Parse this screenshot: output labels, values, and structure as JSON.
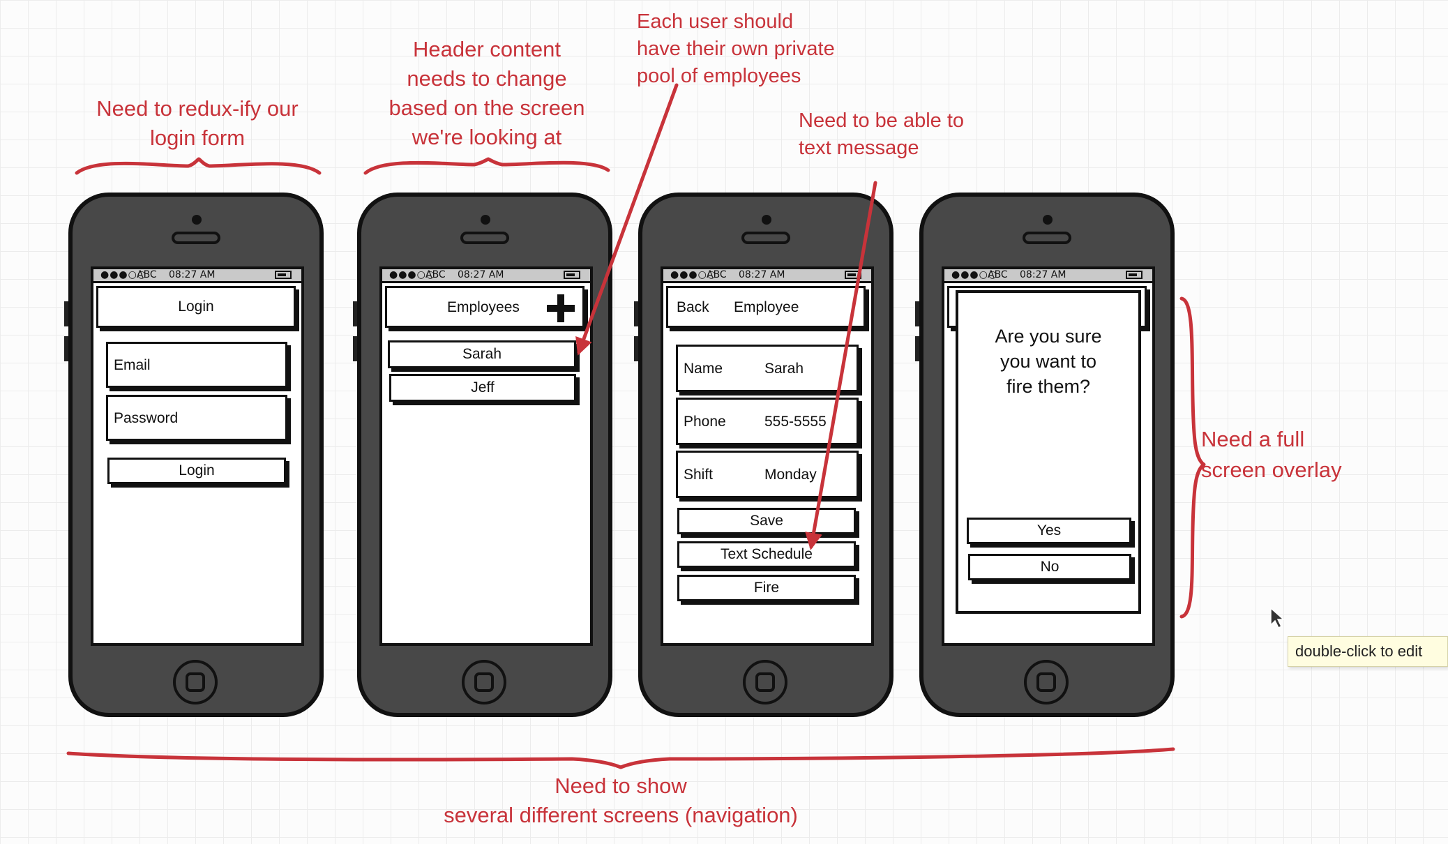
{
  "colors": {
    "annotation": "#c8333a",
    "phone_body": "#484848",
    "outline": "#111111"
  },
  "status_bar": {
    "signal": "●●●○○",
    "carrier": "ABC",
    "time": "08:27 AM"
  },
  "annotations": {
    "login_line1": "Need to redux-ify our",
    "login_line2": "login form",
    "header_line1": "Header content",
    "header_line2": "needs to change",
    "header_line3": "based on the screen",
    "header_line4": "we're looking at",
    "pool_line1": "Each user should",
    "pool_line2": "have their own private",
    "pool_line3": "pool of employees",
    "text_line1": "Need to be able to",
    "text_line2": "text message",
    "overlay_line1": "Need a full",
    "overlay_line2": "screen overlay",
    "nav_line1": "Need to show",
    "nav_line2": "several different screens (navigation)"
  },
  "screens": {
    "login": {
      "header": "Login",
      "email_placeholder": "Email",
      "password_placeholder": "Password",
      "button": "Login"
    },
    "employees": {
      "header": "Employees",
      "add_icon": "plus-icon",
      "items": [
        "Sarah",
        "Jeff"
      ]
    },
    "employee": {
      "back": "Back",
      "header": "Employee",
      "fields": [
        {
          "label": "Name",
          "value": "Sarah"
        },
        {
          "label": "Phone",
          "value": "555-5555"
        },
        {
          "label": "Shift",
          "value": "Monday"
        }
      ],
      "buttons": {
        "save": "Save",
        "text": "Text Schedule",
        "fire": "Fire"
      }
    },
    "confirm": {
      "line1": "Are you sure",
      "line2": "you want to",
      "line3": "fire them?",
      "yes": "Yes",
      "no": "No"
    }
  },
  "tooltip": "double-click to edit",
  "cursor_icon": "mouse-pointer-icon"
}
